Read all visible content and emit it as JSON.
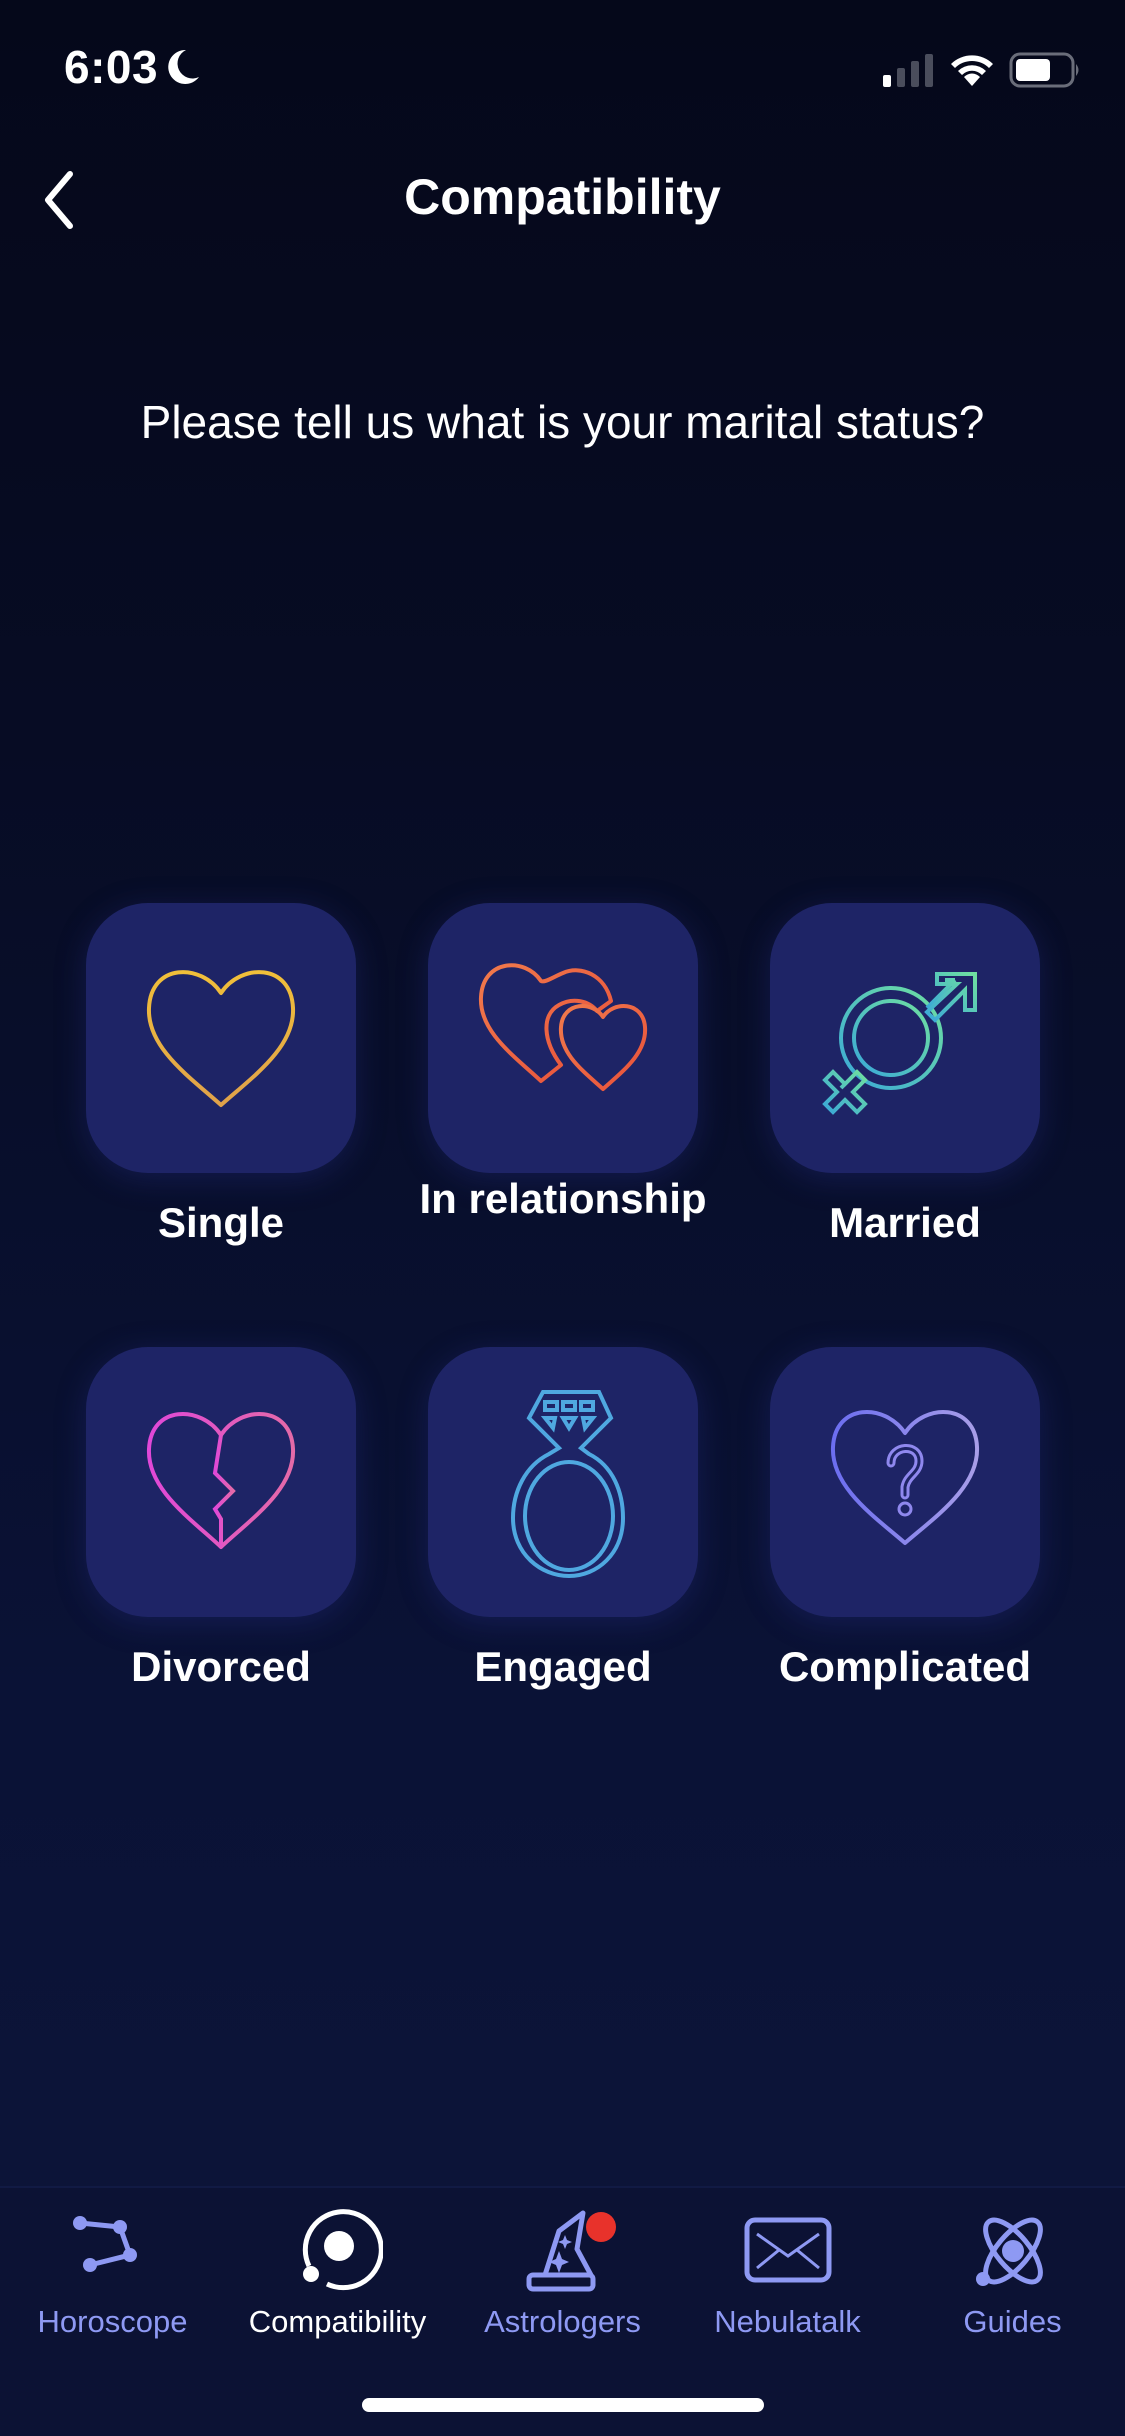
{
  "status_bar": {
    "time": "6:03",
    "icons": [
      "moon-icon",
      "signal-icon",
      "wifi-icon",
      "battery-icon"
    ]
  },
  "nav": {
    "back_icon": "chevron-left-icon",
    "title": "Compatibility"
  },
  "question": "Please tell us what is your marital status?",
  "options": [
    {
      "label": "Single",
      "icon": "heart-icon",
      "color": "#e8b53a"
    },
    {
      "label": "In relationship",
      "icon": "two-hearts-icon",
      "color": "#ee6a4a"
    },
    {
      "label": "Married",
      "icon": "gender-symbols-icon",
      "color": "#3fc6a8"
    },
    {
      "label": "Divorced",
      "icon": "broken-heart-icon",
      "color": "#e05ad0"
    },
    {
      "label": "Engaged",
      "icon": "ring-icon",
      "color": "#4fa8e0"
    },
    {
      "label": "Complicated",
      "icon": "heart-question-icon",
      "color": "#7f7cf0"
    }
  ],
  "tab_bar": {
    "tabs": [
      {
        "label": "Horoscope",
        "icon": "constellation-icon",
        "active": false
      },
      {
        "label": "Compatibility",
        "icon": "orbit-icon",
        "active": true
      },
      {
        "label": "Astrologers",
        "icon": "wizard-hat-icon",
        "active": false,
        "badge": true
      },
      {
        "label": "Nebulatalk",
        "icon": "envelope-icon",
        "active": false
      },
      {
        "label": "Guides",
        "icon": "atom-icon",
        "active": false
      }
    ],
    "inactive_color": "#8e99f3",
    "active_color": "#ffffff",
    "badge_color": "#e8322b"
  }
}
